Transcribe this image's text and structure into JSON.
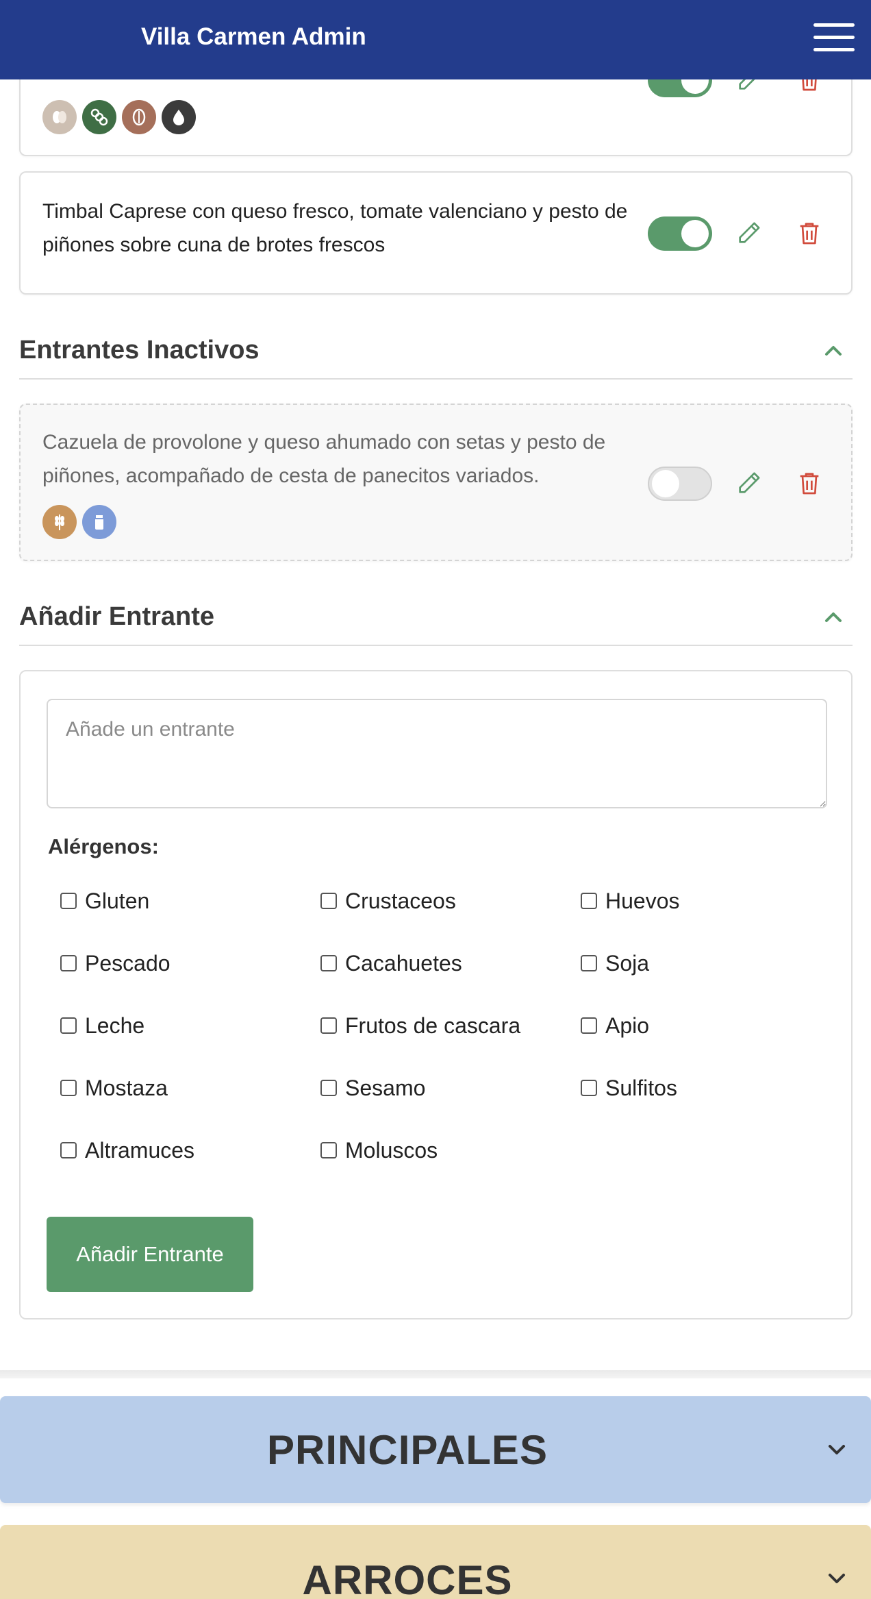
{
  "app": {
    "title": "Villa Carmen Admin"
  },
  "icons": {
    "menu": "hamburger-icon",
    "edit": "pencil-icon",
    "delete": "trash-icon",
    "chevron_up": "chevron-up-icon",
    "chevron_down": "chevron-down-icon"
  },
  "colors": {
    "header": "#233c8c",
    "accent_green": "#5a9a6b",
    "delete_red": "#d14b3c",
    "principales_bg": "#b8cdea",
    "arroces_bg": "#ecdcb2"
  },
  "active_items": [
    {
      "description": "",
      "active": true,
      "allergens": [
        "egg-allergen-icon",
        "soy-allergen-icon",
        "nuts-allergen-icon",
        "mustard-allergen-icon"
      ]
    },
    {
      "description": "Timbal Caprese con queso fresco, tomate valenciano y pesto de piñones sobre cuna de brotes frescos",
      "active": true,
      "allergens": []
    }
  ],
  "inactive_section": {
    "title": "Entrantes Inactivos",
    "items": [
      {
        "description": "Cazuela de provolone y queso ahumado con setas y pesto de piñones, acompañado de cesta de panecitos variados.",
        "active": false,
        "allergens": [
          "gluten-allergen-icon",
          "milk-allergen-icon"
        ]
      }
    ]
  },
  "add_section": {
    "title": "Añadir Entrante",
    "textarea_placeholder": "Añade un entrante",
    "allergens_label": "Alérgenos:",
    "options": [
      "Gluten",
      "Crustaceos",
      "Huevos",
      "Pescado",
      "Cacahuetes",
      "Soja",
      "Leche",
      "Frutos de cascara",
      "Apio",
      "Mostaza",
      "Sesamo",
      "Sulfitos",
      "Altramuces",
      "Moluscos"
    ],
    "submit_label": "Añadir Entrante"
  },
  "categories": [
    {
      "label": "PRINCIPALES",
      "expanded": false
    },
    {
      "label": "ARROCES",
      "expanded": false
    }
  ]
}
